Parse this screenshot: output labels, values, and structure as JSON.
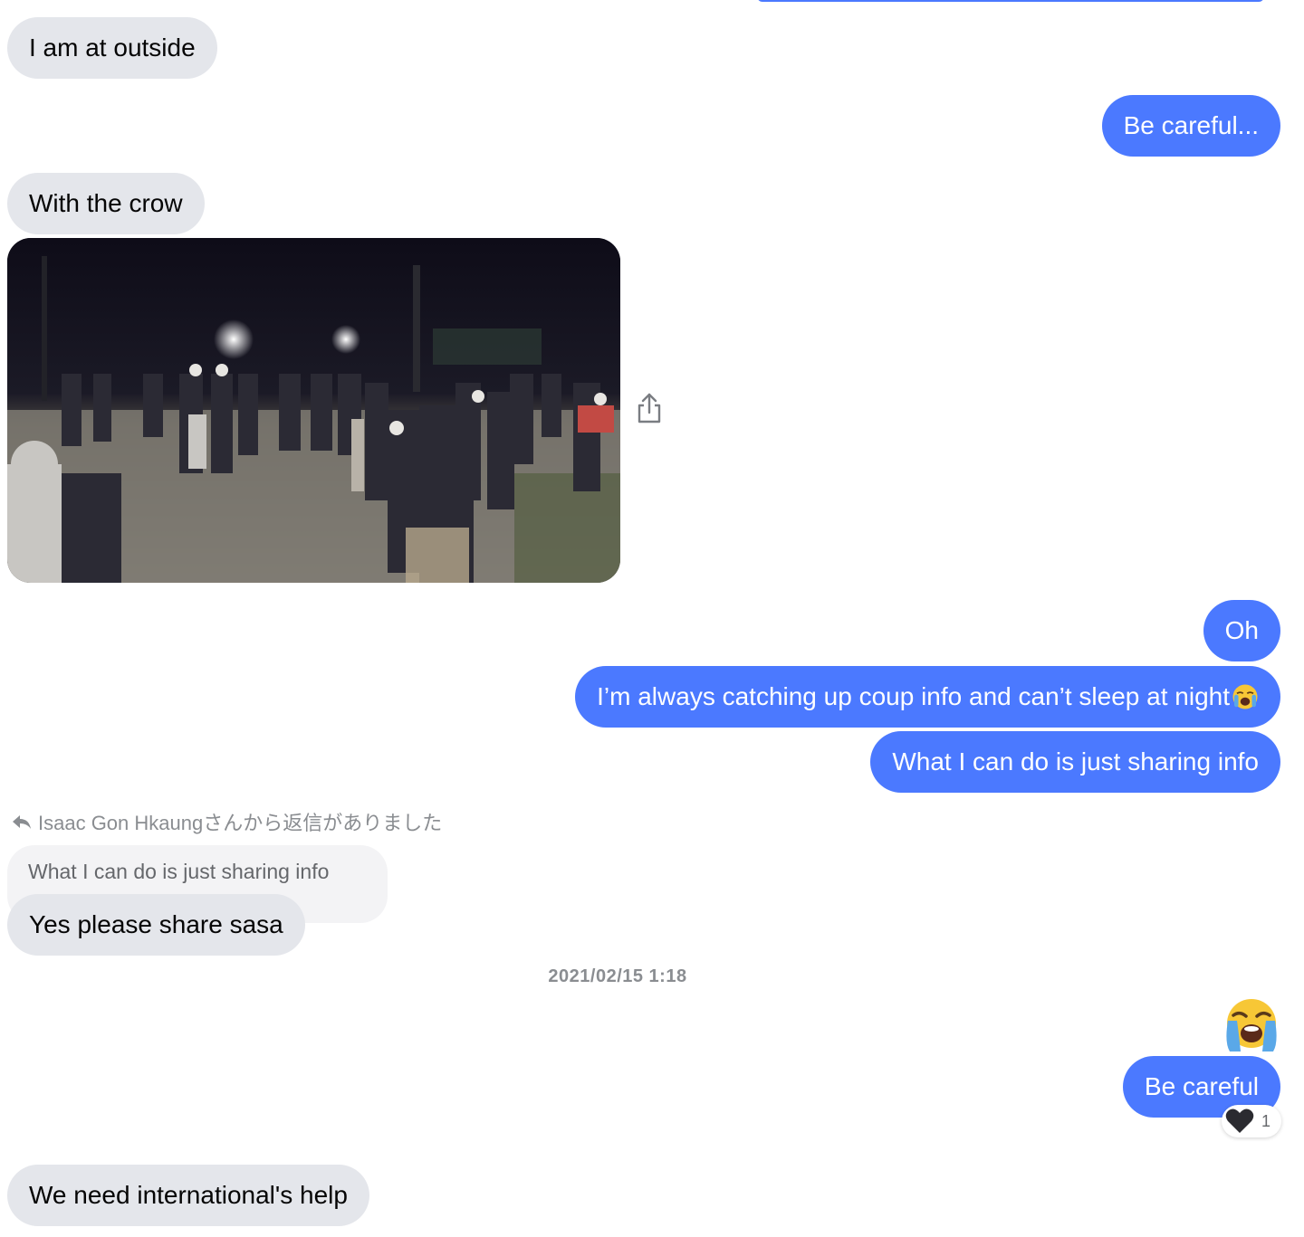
{
  "messages": {
    "m1": "I am at outside",
    "m2": "Be careful...",
    "m3": "With the crow",
    "m4": "Oh",
    "m5": "I’m always catching up coup info and can’t sleep at night",
    "m6": "What I can do is just sharing info",
    "m7": "Yes please share sasa",
    "m8": "Be careful",
    "m9": "We need international's help"
  },
  "reply": {
    "note": "Isaac Gon Hkaungさんから返信がありました",
    "quoted_text": "What I can do is just sharing info"
  },
  "timestamp": "2021/02/15 1:18",
  "reaction": {
    "icon": "black-heart-icon",
    "count": "1"
  },
  "icons": {
    "share": "share-icon",
    "reply": "reply-arrow-icon",
    "emoji": "loudly-crying-face-icon"
  },
  "colors": {
    "outgoing_bubble": "#4b79ff",
    "incoming_bubble": "#e4e6eb",
    "meta_text": "#8a8d91"
  }
}
